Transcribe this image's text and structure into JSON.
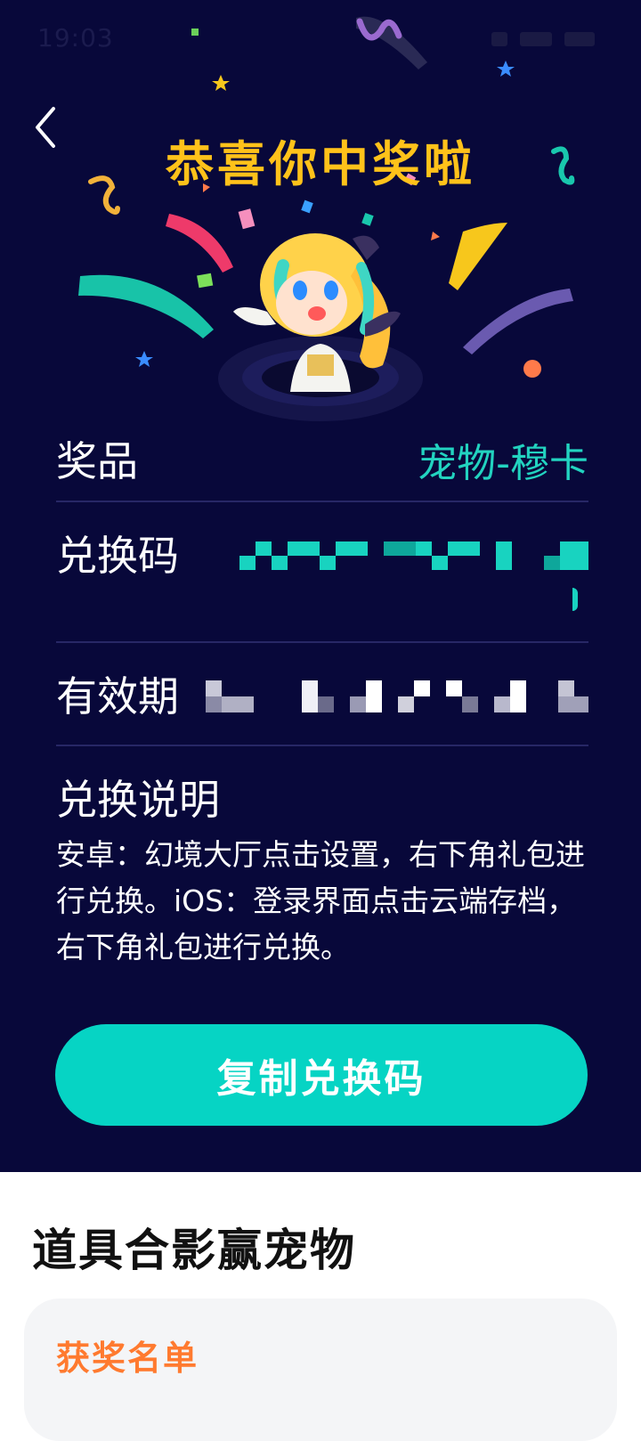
{
  "status_bar": {
    "time": "19:03"
  },
  "header": {
    "title": "恭喜你中奖啦"
  },
  "prize": {
    "label": "奖品",
    "value": "宠物-穆卡"
  },
  "code": {
    "label": "兑换码"
  },
  "validity": {
    "label": "有效期"
  },
  "instructions": {
    "title": "兑换说明",
    "body": "安卓：幻境大厅点击设置，右下角礼包进行兑换。iOS：登录界面点击云端存档，右下角礼包进行兑换。"
  },
  "copy_button": {
    "label": "复制兑换码"
  },
  "section": {
    "title": "道具合影赢宠物"
  },
  "winners": {
    "title": "获奖名单"
  },
  "colors": {
    "background": "#08083a",
    "accent": "#06d4c4",
    "title_yellow": "#ffc21a",
    "winners_orange": "#ff7a2f"
  },
  "icons": [
    "back-arrow-icon",
    "signal-icon",
    "battery-icon"
  ]
}
